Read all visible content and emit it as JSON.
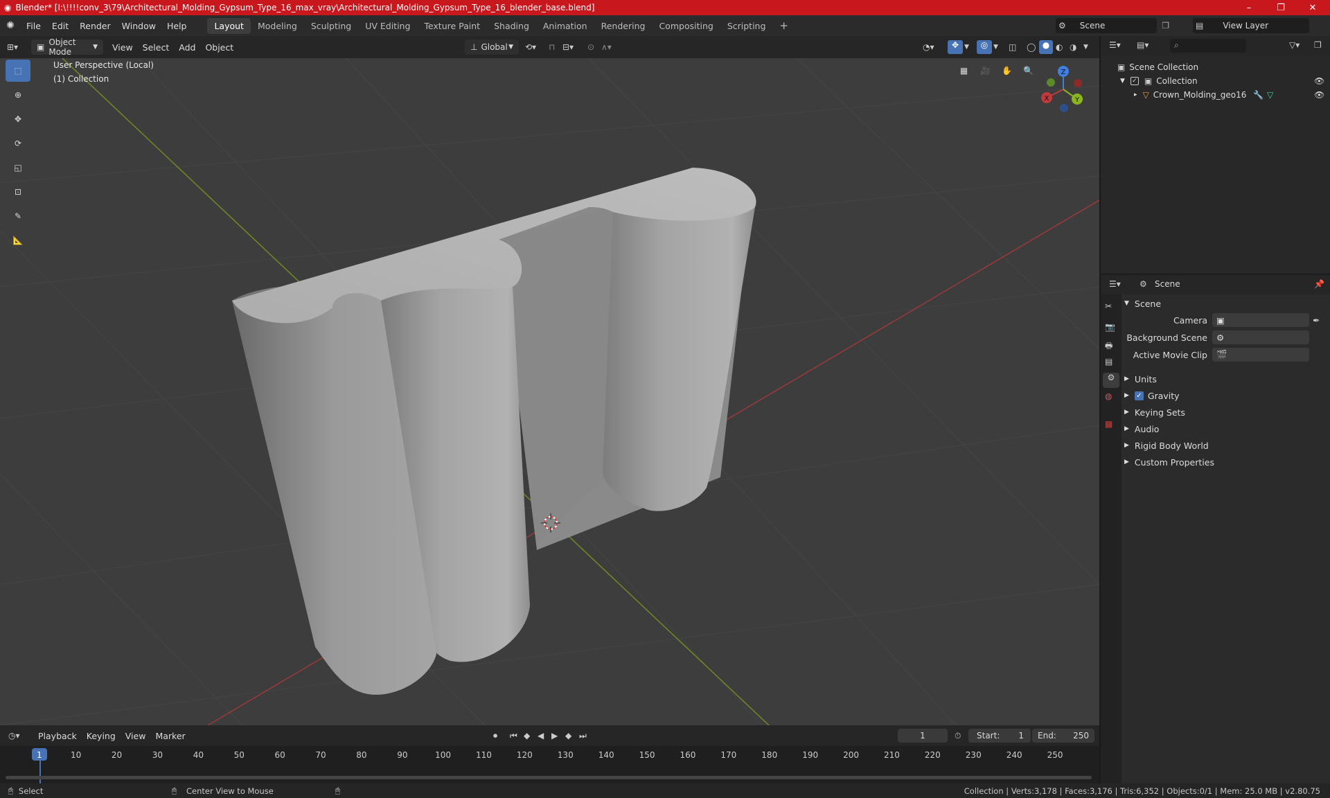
{
  "window": {
    "title": "Blender* [I:\\!!!!conv_3\\79\\Architectural_Molding_Gypsum_Type_16_max_vray\\Architectural_Molding_Gypsum_Type_16_blender_base.blend]",
    "minimize": "–",
    "maximize": "❐",
    "close": "✕"
  },
  "menu": {
    "items": [
      "File",
      "Edit",
      "Render",
      "Window",
      "Help"
    ],
    "workspaces": [
      "Layout",
      "Modeling",
      "Sculpting",
      "UV Editing",
      "Texture Paint",
      "Shading",
      "Animation",
      "Rendering",
      "Compositing",
      "Scripting"
    ],
    "active_workspace": "Layout",
    "add_tab": "+",
    "scene": "Scene",
    "view_layer": "View Layer"
  },
  "viewport_header": {
    "mode": "Object Mode",
    "menus": [
      "View",
      "Select",
      "Add",
      "Object"
    ],
    "orientation": "Global"
  },
  "viewport": {
    "perspective": "User Perspective (Local)",
    "collection": "(1) Collection",
    "gizmo": {
      "x": "X",
      "y": "Y",
      "z": "Z"
    }
  },
  "outliner": {
    "search_placeholder": "",
    "rows": {
      "scene_collection": "Scene Collection",
      "collection": "Collection",
      "object": "Crown_Molding_geo16"
    }
  },
  "properties": {
    "header": "Scene",
    "panel": "Scene",
    "camera_label": "Camera",
    "background_scene_label": "Background Scene",
    "active_movie_clip_label": "Active Movie Clip",
    "sections": [
      "Units",
      "Gravity",
      "Keying Sets",
      "Audio",
      "Rigid Body World",
      "Custom Properties"
    ],
    "gravity_checked": true
  },
  "timeline": {
    "menus": [
      "Playback",
      "Keying",
      "View",
      "Marker"
    ],
    "current_frame": "1",
    "start_label": "Start:",
    "start": "1",
    "end_label": "End:",
    "end": "250",
    "ruler": [
      "1",
      "10",
      "20",
      "30",
      "40",
      "50",
      "60",
      "70",
      "80",
      "90",
      "100",
      "110",
      "120",
      "130",
      "140",
      "150",
      "160",
      "170",
      "180",
      "190",
      "200",
      "210",
      "220",
      "230",
      "240",
      "250"
    ]
  },
  "status": {
    "select": "Select",
    "center_view": "Center View to Mouse",
    "stats": "Collection | Verts:3,178 | Faces:3,176 | Tris:6,352 | Objects:0/1 | Mem: 25.0 MB | v2.80.75"
  },
  "colors": {
    "titlebar": "#c9171e",
    "accent": "#4772b3",
    "x_axis": "#c0393b",
    "y_axis": "#8ab51c",
    "z_axis": "#3f7fe0"
  }
}
